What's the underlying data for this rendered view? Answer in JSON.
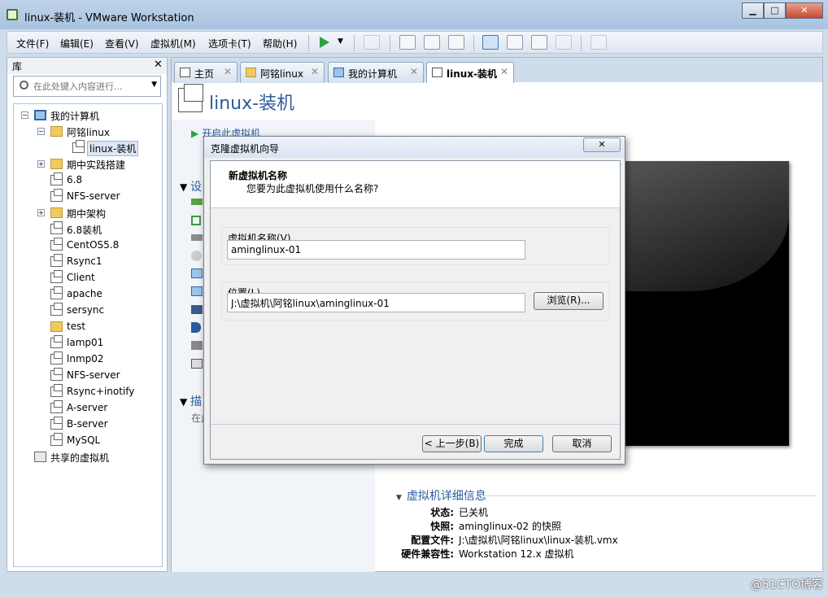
{
  "window": {
    "title": "linux-装机 - VMware Workstation",
    "minimize": "▁",
    "maximize": "□",
    "close": "✕"
  },
  "menu": [
    "文件(F)",
    "编辑(E)",
    "查看(V)",
    "虚拟机(M)",
    "选项卡(T)",
    "帮助(H)"
  ],
  "library": {
    "title": "库",
    "close": "✕",
    "search_placeholder": "在此处键入内容进行...",
    "tree": [
      {
        "label": "我的计算机",
        "expander": "−",
        "icon": "computer-icon"
      },
      {
        "label": "阿铭linux",
        "expander": "−",
        "icon": "folder-icon"
      },
      {
        "label": "linux-装机",
        "icon": "vm-icon",
        "selected": true
      },
      {
        "label": "期中实践搭建",
        "expander": "+",
        "icon": "folder-icon"
      },
      {
        "label": "6.8",
        "icon": "vm-icon"
      },
      {
        "label": "NFS-server",
        "icon": "vm-icon"
      },
      {
        "label": "期中架构",
        "expander": "+",
        "icon": "folder-icon"
      },
      {
        "label": "6.8装机",
        "icon": "vm-icon"
      },
      {
        "label": "CentOS5.8",
        "icon": "vm-icon"
      },
      {
        "label": "Rsync1",
        "icon": "vm-icon"
      },
      {
        "label": "Client",
        "icon": "vm-icon"
      },
      {
        "label": "apache",
        "icon": "vm-icon"
      },
      {
        "label": "sersync",
        "icon": "vm-icon"
      },
      {
        "label": "test",
        "icon": "folder-icon"
      },
      {
        "label": "lamp01",
        "icon": "vm-icon"
      },
      {
        "label": "lnmp02",
        "icon": "vm-icon"
      },
      {
        "label": "NFS-server",
        "icon": "vm-icon"
      },
      {
        "label": "Rsync+inotify",
        "icon": "vm-icon"
      },
      {
        "label": "A-server",
        "icon": "vm-icon"
      },
      {
        "label": "B-server",
        "icon": "vm-icon"
      },
      {
        "label": "MySQL",
        "icon": "vm-icon"
      },
      {
        "label": "共享的虚拟机",
        "icon": "shared-vm-icon"
      }
    ]
  },
  "tabs": [
    {
      "label": "主页",
      "close": "✕"
    },
    {
      "label": "阿铭linux",
      "close": "✕"
    },
    {
      "label": "我的计算机",
      "close": "✕"
    },
    {
      "label": "linux-装机",
      "close": "✕",
      "active": true
    }
  ],
  "vm": {
    "title": "linux-装机",
    "power_on": "开启此虚拟机",
    "devices_partial": "设",
    "desc_partial": "描",
    "desc_sub_partial": "在此"
  },
  "details": {
    "heading": "虚拟机详细信息",
    "rows": [
      {
        "key": "状态:",
        "value": "已关机"
      },
      {
        "key": "快照:",
        "value": "aminglinux-02 的快照"
      },
      {
        "key": "配置文件:",
        "value": "J:\\虚拟机\\阿铭linux\\linux-装机.vmx"
      },
      {
        "key": "硬件兼容性:",
        "value": "Workstation 12.x 虚拟机"
      }
    ]
  },
  "dialog": {
    "title": "克隆虚拟机向导",
    "close": "✕",
    "heading": "新虚拟机名称",
    "subheading": "您要为此虚拟机使用什么名称?",
    "name_label": "虚拟机名称(V)",
    "name_value": "aminglinux-01",
    "location_label": "位置(L)",
    "location_value": "J:\\虚拟机\\阿铭linux\\aminglinux-01",
    "browse": "浏览(R)...",
    "back": "< 上一步(B)",
    "finish": "完成",
    "cancel": "取消"
  },
  "watermark": "@51CTO博客"
}
